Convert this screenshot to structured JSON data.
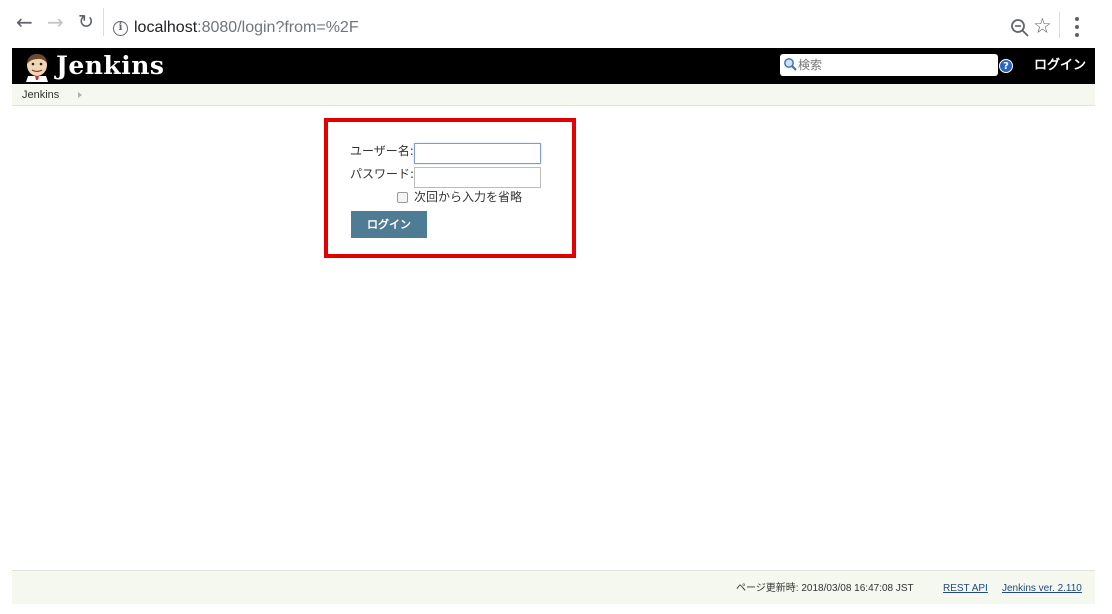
{
  "browser": {
    "url_host": "localhost",
    "url_rest": ":8080/login?from=%2F",
    "icons": [
      "back-icon",
      "forward-icon",
      "reload-icon",
      "info-icon",
      "zoom-icon",
      "star-icon",
      "menu-icon"
    ]
  },
  "header": {
    "title": "Jenkins",
    "search_placeholder": "検索",
    "help_glyph": "?",
    "login_link": "ログイン",
    "colors": {
      "background": "#000000",
      "text": "#ffffff"
    }
  },
  "breadcrumb": {
    "items": [
      "Jenkins"
    ]
  },
  "login_form": {
    "username_label": "ユーザー名:",
    "username_value": "",
    "password_label": "パスワード:",
    "password_value": "",
    "remember_label": "次回から入力を省略",
    "remember_checked": false,
    "submit_label": "ログイン",
    "highlight_color": "#e30000",
    "button_color": "#4e7c95"
  },
  "footer": {
    "page_updated": "ページ更新時: 2018/03/08 16:47:08 JST",
    "rest_api": "REST API",
    "version": "Jenkins ver. 2.110"
  }
}
